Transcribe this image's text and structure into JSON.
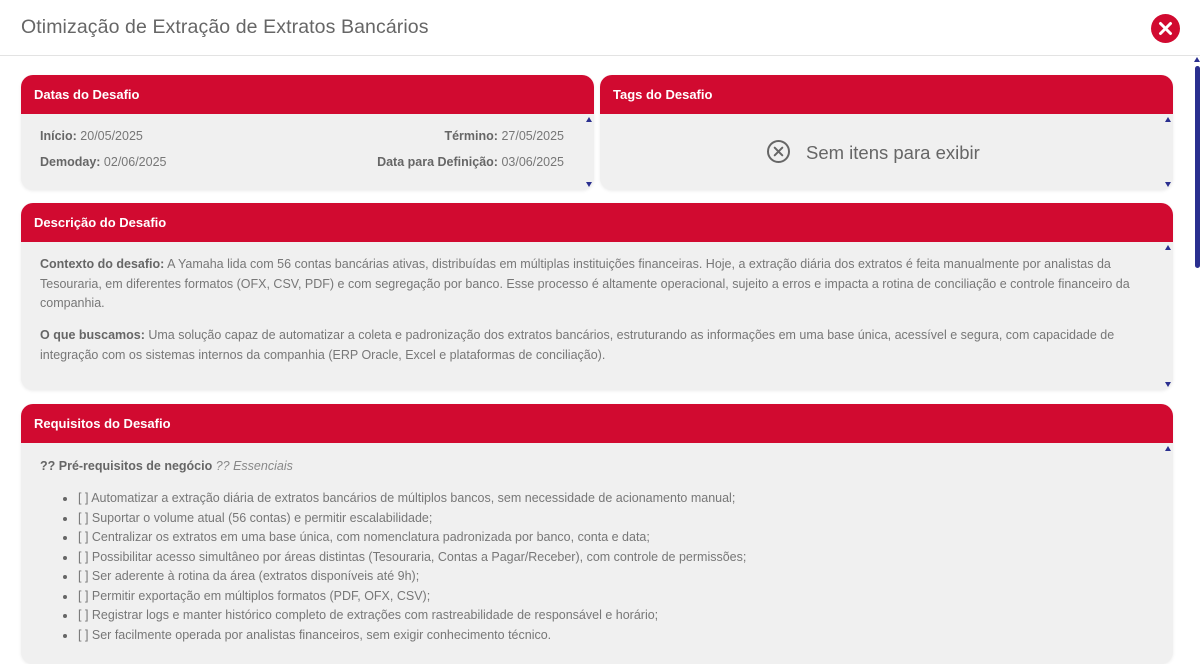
{
  "modal": {
    "title": "Otimização de Extração de Extratos Bancários",
    "close_icon": "close-icon"
  },
  "dates_card": {
    "title": "Datas do Desafio",
    "inicio_label": "Início:",
    "inicio_value": "20/05/2025",
    "termino_label": "Término:",
    "termino_value": "27/05/2025",
    "demoday_label": "Demoday:",
    "demoday_value": "02/06/2025",
    "definicao_label": "Data para Definição:",
    "definicao_value": "03/06/2025"
  },
  "tags_card": {
    "title": "Tags do Desafio",
    "empty_text": "Sem itens para exibir",
    "empty_icon": "circle-x-icon"
  },
  "description_card": {
    "title": "Descrição do Desafio",
    "context_label": "Contexto do desafio:",
    "context_text": " A Yamaha lida com 56 contas bancárias ativas, distribuídas em múltiplas instituições financeiras. Hoje, a extração diária dos extratos é feita manualmente por analistas da Tesouraria, em diferentes formatos (OFX, CSV, PDF) e com segregação por banco. Esse processo é altamente operacional, sujeito a erros e impacta a rotina de conciliação e controle financeiro da companhia.",
    "seek_label": "O que buscamos:",
    "seek_text": " Uma solução capaz de automatizar a coleta e padronização dos extratos bancários, estruturando as informações em uma base única, acessível e segura, com capacidade de integração com os sistemas internos da companhia (ERP Oracle, Excel e plataformas de conciliação)."
  },
  "requirements_card": {
    "title": "Requisitos do Desafio",
    "section_label": "?? Pré-requisitos de negócio",
    "section_note": " ?? Essenciais",
    "items": [
      "[ ] Automatizar a extração diária de extratos bancários de múltiplos bancos, sem necessidade de acionamento manual;",
      "[ ] Suportar o volume atual (56 contas) e permitir escalabilidade;",
      "[ ] Centralizar os extratos em uma base única, com nomenclatura padronizada por banco, conta e data;",
      "[ ] Possibilitar acesso simultâneo por áreas distintas (Tesouraria, Contas a Pagar/Receber), com controle de permissões;",
      "[ ] Ser aderente à rotina da área (extratos disponíveis até 9h);",
      "[ ] Permitir exportação em múltiplos formatos (PDF, OFX, CSV);",
      "[ ] Registrar logs e manter histórico completo de extrações com rastreabilidade de responsável e horário;",
      "[ ] Ser facilmente operada por analistas financeiros, sem exigir conhecimento técnico."
    ]
  },
  "colors": {
    "accent": "#d10a30",
    "card_bg": "#f0f0f0",
    "scrollbar": "#2a2f8f"
  }
}
